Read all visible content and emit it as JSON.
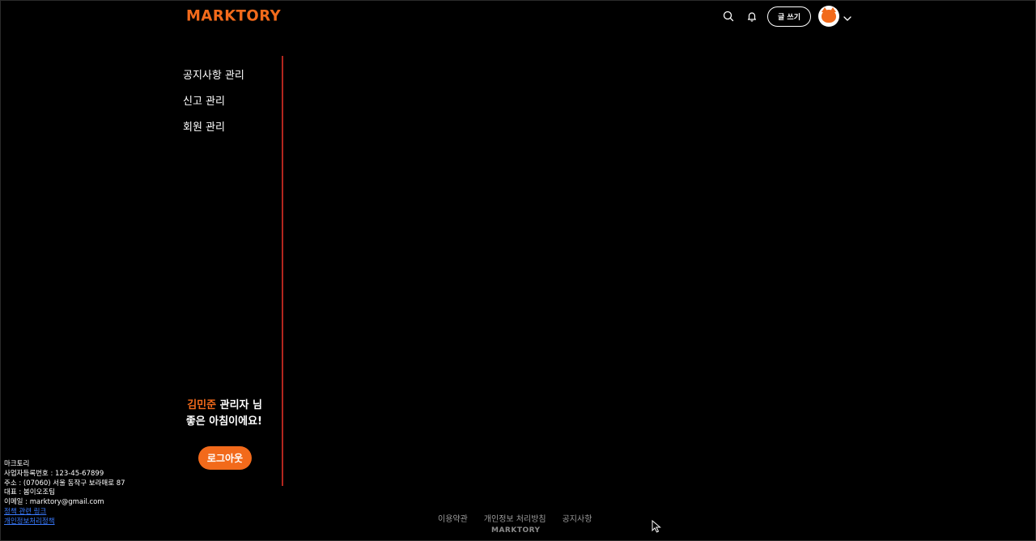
{
  "header": {
    "logo": "MARKTORY",
    "search_icon": "search-icon",
    "bell_icon": "bell-icon",
    "write_label": "글 쓰기",
    "avatar_icon": "cat-avatar-icon",
    "dropdown_icon": "chevron-down-icon"
  },
  "sidebar": {
    "items": [
      {
        "label": "공지사항 관리"
      },
      {
        "label": "신고 관리"
      },
      {
        "label": "회원 관리"
      }
    ],
    "greeting_name": "김민준",
    "greeting_role": " 관리자 님",
    "greeting_message": "좋은 아침이에요!",
    "logout_label": "로그아웃"
  },
  "company": {
    "name": "마크토리",
    "business_no": "사업자등록번호 : 123-45-67899",
    "address": "주소 : (07060) 서울 동작구 보라매로 87",
    "ceo": "대표 : 봄이오조팀",
    "email": "이메일 : marktory@gmail.com",
    "policy_link": "정책 관련 링크",
    "privacy_link": "개인정보처리정책"
  },
  "footer": {
    "links": [
      "이용약관",
      "개인정보 처리방침",
      "공지사항"
    ],
    "logo": "MARKTORY"
  },
  "colors": {
    "brand": "#f26a1b",
    "divider": "#b3261e",
    "background": "#000000"
  }
}
